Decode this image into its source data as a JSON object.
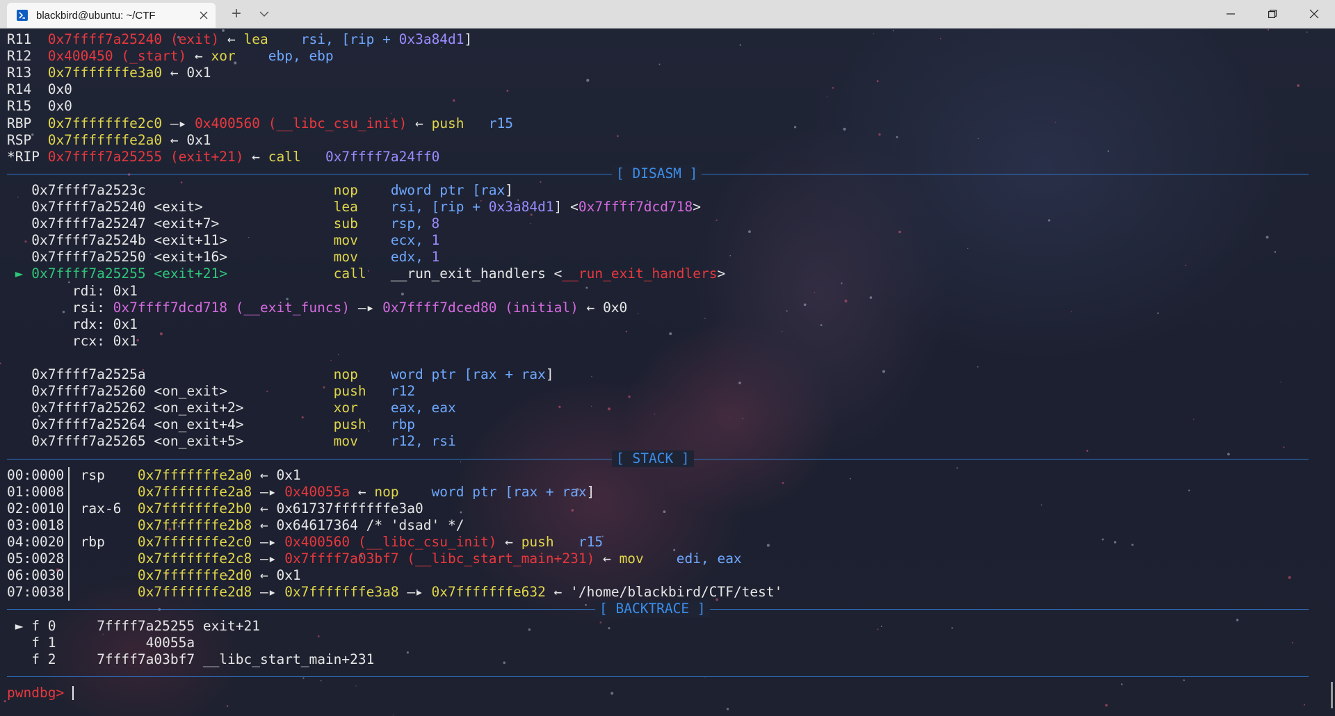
{
  "window": {
    "tab_title": "blackbird@ubuntu: ~/CTF",
    "tab_icon": "terminal-icon",
    "new_tab_symbol": "+",
    "colors": {
      "accent_blue": "#3b8eea",
      "red": "#e8383d",
      "yellow": "#e0d64a",
      "magenta": "#d66ae0",
      "green": "#2fc57a",
      "white": "#e6e6e6"
    }
  },
  "registers": [
    {
      "name": "R11",
      "value": "0x7ffff7a25240",
      "sym": "(exit)",
      "arrow": "←",
      "rest": [
        {
          "t": "lea",
          "c": "y"
        },
        {
          "t": "    rsi, [rip + ",
          "c": "b"
        },
        {
          "t": "0x3a84d1",
          "c": "pv"
        },
        {
          "t": "]",
          "c": "w"
        }
      ]
    },
    {
      "name": "R12",
      "value": "0x400450",
      "sym": "(_start)",
      "arrow": "←",
      "rest": [
        {
          "t": "xor",
          "c": "y"
        },
        {
          "t": "    ebp, ebp",
          "c": "b"
        }
      ]
    },
    {
      "name": "R13",
      "value": "0x7fffffffe3a0",
      "arrow": "←",
      "tail": "0x1"
    },
    {
      "name": "R14",
      "value": "0x0"
    },
    {
      "name": "R15",
      "value": "0x0"
    },
    {
      "name": "RBP",
      "value": "0x7fffffffe2c0",
      "arrow": "—▸",
      "target": "0x400560",
      "target_sym": "(__libc_csu_init)",
      "arrow2": "←",
      "rest": [
        {
          "t": "push",
          "c": "y"
        },
        {
          "t": "   r15",
          "c": "b"
        }
      ]
    },
    {
      "name": "RSP",
      "value": "0x7fffffffe2a0",
      "arrow": "←",
      "tail": "0x1"
    },
    {
      "name": "*RIP",
      "value": "0x7ffff7a25255",
      "sym": "(exit+21)",
      "arrow": "←",
      "rest": [
        {
          "t": "call",
          "c": "y"
        },
        {
          "t": "   ",
          "c": "w"
        },
        {
          "t": "0x7ffff7a24ff0",
          "c": "pv"
        }
      ]
    }
  ],
  "sections": {
    "disasm": "[ DISASM ]",
    "stack": "[ STACK ]",
    "backtrace": "[ BACKTRACE ]"
  },
  "disasm": [
    {
      "addr": "0x7ffff7a2523c",
      "sym": "",
      "op": "nop",
      "args": [
        {
          "t": "dword ptr [",
          "c": "b"
        },
        {
          "t": "rax",
          "c": "b"
        },
        {
          "t": "]",
          "c": "w"
        }
      ]
    },
    {
      "addr": "0x7ffff7a25240",
      "sym": "<exit>",
      "op": "lea",
      "args": [
        {
          "t": "rsi, [rip + ",
          "c": "b"
        },
        {
          "t": "0x3a84d1",
          "c": "pv"
        },
        {
          "t": "] <",
          "c": "w"
        },
        {
          "t": "0x7ffff7dcd718",
          "c": "m"
        },
        {
          "t": ">",
          "c": "w"
        }
      ]
    },
    {
      "addr": "0x7ffff7a25247",
      "sym": "<exit+7>",
      "op": "sub",
      "args": [
        {
          "t": "rsp, ",
          "c": "b"
        },
        {
          "t": "8",
          "c": "pv"
        }
      ]
    },
    {
      "addr": "0x7ffff7a2524b",
      "sym": "<exit+11>",
      "op": "mov",
      "args": [
        {
          "t": "ecx, ",
          "c": "b"
        },
        {
          "t": "1",
          "c": "pv"
        }
      ]
    },
    {
      "addr": "0x7ffff7a25250",
      "sym": "<exit+16>",
      "op": "mov",
      "args": [
        {
          "t": "edx, ",
          "c": "b"
        },
        {
          "t": "1",
          "c": "pv"
        }
      ]
    },
    {
      "addr": "0x7ffff7a25255",
      "sym": "<exit+21>",
      "op": "call",
      "current": true,
      "args": [
        {
          "t": "__run_exit_handlers",
          "c": "w"
        },
        {
          "t": " <",
          "c": "w"
        },
        {
          "t": "__run_exit_handlers",
          "c": "r"
        },
        {
          "t": ">",
          "c": "w"
        }
      ]
    }
  ],
  "call_args": [
    {
      "reg": "rdi:",
      "parts": [
        {
          "t": "0x1",
          "c": "w"
        }
      ]
    },
    {
      "reg": "rsi:",
      "parts": [
        {
          "t": "0x7ffff7dcd718 (__exit_funcs)",
          "c": "m"
        },
        {
          "t": " —▸ ",
          "c": "w"
        },
        {
          "t": "0x7ffff7dced80 (initial)",
          "c": "m"
        },
        {
          "t": " ← 0x0",
          "c": "w"
        }
      ]
    },
    {
      "reg": "rdx:",
      "parts": [
        {
          "t": "0x1",
          "c": "w"
        }
      ]
    },
    {
      "reg": "rcx:",
      "parts": [
        {
          "t": "0x1",
          "c": "w"
        }
      ]
    }
  ],
  "disasm2": [
    {
      "addr": "0x7ffff7a2525a",
      "sym": "",
      "op": "nop",
      "args": [
        {
          "t": "word ptr [",
          "c": "b"
        },
        {
          "t": "rax + rax",
          "c": "b"
        },
        {
          "t": "]",
          "c": "w"
        }
      ]
    },
    {
      "addr": "0x7ffff7a25260",
      "sym": "<on_exit>",
      "op": "push",
      "args": [
        {
          "t": "r12",
          "c": "b"
        }
      ]
    },
    {
      "addr": "0x7ffff7a25262",
      "sym": "<on_exit+2>",
      "op": "xor",
      "args": [
        {
          "t": "eax, eax",
          "c": "b"
        }
      ]
    },
    {
      "addr": "0x7ffff7a25264",
      "sym": "<on_exit+4>",
      "op": "push",
      "args": [
        {
          "t": "rbp",
          "c": "b"
        }
      ]
    },
    {
      "addr": "0x7ffff7a25265",
      "sym": "<on_exit+5>",
      "op": "mov",
      "args": [
        {
          "t": "r12, rsi",
          "c": "b"
        }
      ]
    }
  ],
  "stack": [
    {
      "idx": "00:0000",
      "reg": "rsp",
      "addr": "0x7fffffffe2a0",
      "parts": [
        {
          "t": " ← 0x1",
          "c": "w"
        }
      ]
    },
    {
      "idx": "01:0008",
      "reg": "",
      "addr": "0x7fffffffe2a8",
      "parts": [
        {
          "t": " —▸ ",
          "c": "w"
        },
        {
          "t": "0x40055a",
          "c": "r"
        },
        {
          "t": " ← ",
          "c": "w"
        },
        {
          "t": "nop",
          "c": "y"
        },
        {
          "t": "    word ptr [",
          "c": "b"
        },
        {
          "t": "rax + rax",
          "c": "b"
        },
        {
          "t": "]",
          "c": "w"
        }
      ]
    },
    {
      "idx": "02:0010",
      "reg": "rax-6",
      "addr": "0x7fffffffe2b0",
      "parts": [
        {
          "t": " ← 0x61737fffffffe3a0",
          "c": "w"
        }
      ]
    },
    {
      "idx": "03:0018",
      "reg": "",
      "addr": "0x7fffffffe2b8",
      "parts": [
        {
          "t": " ← 0x64617364 /* 'dsad' */",
          "c": "w"
        }
      ]
    },
    {
      "idx": "04:0020",
      "reg": "rbp",
      "addr": "0x7fffffffe2c0",
      "parts": [
        {
          "t": " —▸ ",
          "c": "w"
        },
        {
          "t": "0x400560 (__libc_csu_init)",
          "c": "r"
        },
        {
          "t": " ← ",
          "c": "w"
        },
        {
          "t": "push",
          "c": "y"
        },
        {
          "t": "   r15",
          "c": "b"
        }
      ]
    },
    {
      "idx": "05:0028",
      "reg": "",
      "addr": "0x7fffffffe2c8",
      "parts": [
        {
          "t": " —▸ ",
          "c": "w"
        },
        {
          "t": "0x7ffff7a03bf7 (__libc_start_main+231)",
          "c": "r"
        },
        {
          "t": " ← ",
          "c": "w"
        },
        {
          "t": "mov",
          "c": "y"
        },
        {
          "t": "    edi, eax",
          "c": "b"
        }
      ]
    },
    {
      "idx": "06:0030",
      "reg": "",
      "addr": "0x7fffffffe2d0",
      "parts": [
        {
          "t": " ← 0x1",
          "c": "w"
        }
      ]
    },
    {
      "idx": "07:0038",
      "reg": "",
      "addr": "0x7fffffffe2d8",
      "parts": [
        {
          "t": " —▸ ",
          "c": "w"
        },
        {
          "t": "0x7fffffffe3a8",
          "c": "y"
        },
        {
          "t": " —▸ ",
          "c": "w"
        },
        {
          "t": "0x7fffffffe632",
          "c": "y"
        },
        {
          "t": " ← '/home/blackbird/CTF/test'",
          "c": "w"
        }
      ]
    }
  ],
  "backtrace": [
    {
      "marker": "►",
      "frame": "f 0",
      "addr": "7ffff7a25255",
      "sym": "exit+21"
    },
    {
      "marker": "",
      "frame": "f 1",
      "addr": "      40055a",
      "sym": ""
    },
    {
      "marker": "",
      "frame": "f 2",
      "addr": "7ffff7a03bf7",
      "sym": "__libc_start_main+231"
    }
  ],
  "prompt": "pwndbg>"
}
